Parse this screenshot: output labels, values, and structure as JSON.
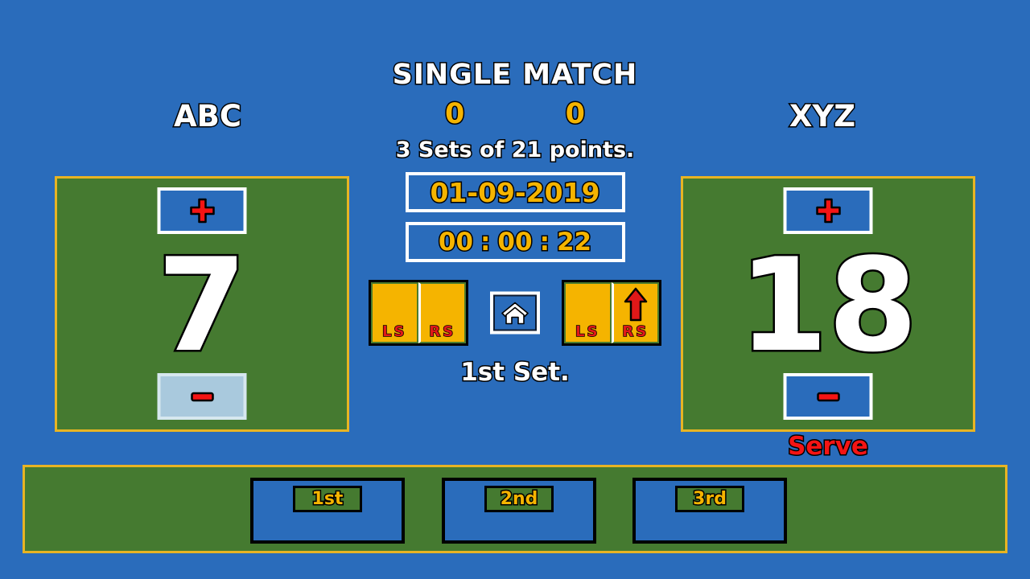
{
  "app": {
    "background_color": "#2a6cbb",
    "panel_color": "#457a30",
    "gold_color": "#e8b423",
    "accent_gold": "#f5b400",
    "accent_red": "#f41414"
  },
  "header": {
    "match_title": "SINGLE MATCH",
    "sets_won_left": "0",
    "sets_won_right": "0",
    "format": "3 Sets of 21 points.",
    "date": "01-09-2019",
    "timer": {
      "hours": "00",
      "sep1": ":",
      "minutes": "00",
      "sep2": ":",
      "seconds": "22"
    }
  },
  "teams": {
    "left": {
      "name": "ABC",
      "score": "7",
      "plus_label": "+",
      "minus_label": "-",
      "minus_pressed": true
    },
    "right": {
      "name": "XYZ",
      "score": "18",
      "plus_label": "+",
      "minus_label": "-",
      "minus_pressed": false,
      "serve_label": "Serve"
    }
  },
  "serve_controls": {
    "left": {
      "ls_label": "LS",
      "rs_label": "RS",
      "active": null
    },
    "right": {
      "ls_label": "LS",
      "rs_label": "RS",
      "active": "RS"
    },
    "home_icon": "home-icon"
  },
  "status": {
    "current_set": "1st Set."
  },
  "set_bar": {
    "buttons": [
      {
        "label": "1st"
      },
      {
        "label": "2nd"
      },
      {
        "label": "3rd"
      }
    ]
  }
}
